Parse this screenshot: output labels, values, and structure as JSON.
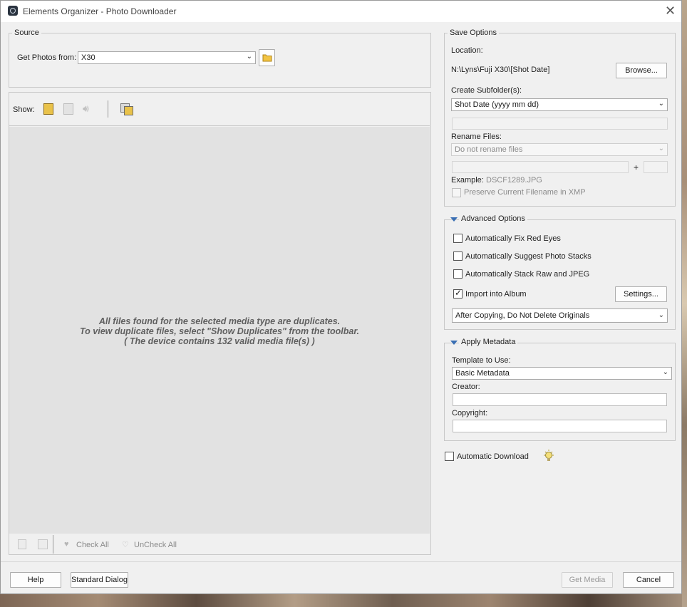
{
  "window": {
    "title": "Elements Organizer - Photo Downloader",
    "close_glyph": "✕"
  },
  "source": {
    "legend": "Source",
    "get_photos_label": "Get Photos from:",
    "device": "X30",
    "folder_icon": "folder-icon"
  },
  "toolbar": {
    "show_label": "Show:",
    "icons": [
      "photo-icon",
      "video-icon",
      "audio-icon",
      "duplicates-icon"
    ]
  },
  "media": {
    "message_line1": "All files found for the selected media type are duplicates.",
    "message_line2": "To view duplicate files, select \"Show Duplicates\" from the toolbar.",
    "message_line3": "( The device contains 132 valid media file(s) )"
  },
  "bottom_bar": {
    "check_all": "Check All",
    "uncheck_all": "UnCheck All"
  },
  "save_options": {
    "legend": "Save Options",
    "location_label": "Location:",
    "location_value": "N:\\Lyns\\Fuji X30\\[Shot Date]",
    "browse": "Browse...",
    "subfolder_label": "Create Subfolder(s):",
    "subfolder_value": "Shot Date (yyyy mm dd)",
    "rename_label": "Rename Files:",
    "rename_value": "Do not rename files",
    "plus": "+",
    "example_label": "Example:",
    "example_value": "DSCF1289.JPG",
    "preserve_label": "Preserve Current Filename in XMP"
  },
  "advanced": {
    "legend": "Advanced Options",
    "red_eyes": "Automatically Fix Red Eyes",
    "suggest_stacks": "Automatically Suggest Photo Stacks",
    "stack_raw": "Automatically Stack Raw and JPEG",
    "import_album": "Import into Album",
    "settings": "Settings...",
    "after_copy": "After Copying, Do Not Delete Originals"
  },
  "metadata": {
    "legend": "Apply Metadata",
    "template_label": "Template to Use:",
    "template_value": "Basic Metadata",
    "creator_label": "Creator:",
    "copyright_label": "Copyright:"
  },
  "auto_download": "Automatic Download",
  "footer": {
    "help": "Help",
    "standard_dialog": "Standard Dialog",
    "get_media": "Get Media",
    "cancel": "Cancel"
  },
  "colors": {
    "accent": "#3a6fb4",
    "window_bg": "#f0f0f0",
    "media_bg": "#e2e2e2"
  }
}
